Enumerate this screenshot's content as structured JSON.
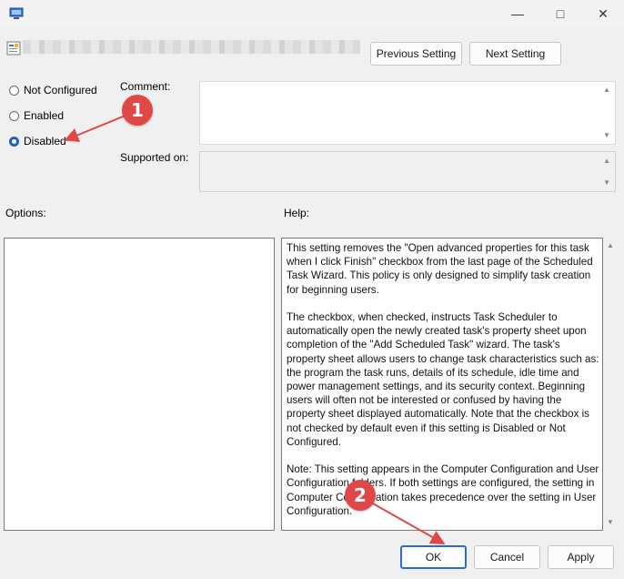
{
  "window": {
    "minimize_glyph": "—",
    "maximize_glyph": "□",
    "close_glyph": "✕"
  },
  "header": {
    "previous_setting": "Previous Setting",
    "next_setting": "Next Setting"
  },
  "state": {
    "options": [
      "Not Configured",
      "Enabled",
      "Disabled"
    ],
    "selected": "Disabled"
  },
  "comment_label": "Comment:",
  "supported_on_label": "Supported on:",
  "options_label": "Options:",
  "help_label": "Help:",
  "help_paragraphs": [
    "This setting removes the \"Open advanced properties for this task when I click Finish\" checkbox from the last page of the Scheduled Task Wizard.  This policy is only designed to simplify task creation for beginning users.",
    "The checkbox, when checked, instructs Task Scheduler to automatically open the newly created task's property sheet upon completion of the \"Add Scheduled Task\" wizard.  The task's property sheet allows users to change task characteristics such as: the program the task runs, details of its schedule, idle time and power management settings, and its security context. Beginning users will often not be interested or confused by having the property sheet displayed automatically.  Note that the checkbox is not checked by default even if this setting is Disabled or Not Configured.",
    "Note: This setting appears in the Computer Configuration and User Configuration folders. If both settings are configured, the setting in Computer Configuration takes precedence over the setting in User Configuration."
  ],
  "footer": {
    "ok": "OK",
    "cancel": "Cancel",
    "apply": "Apply"
  },
  "annotations": [
    {
      "number": "1",
      "target": "Disabled"
    },
    {
      "number": "2",
      "target": "OK"
    }
  ],
  "colors": {
    "accent": "#1f5fbf",
    "marker": "#e04848"
  }
}
